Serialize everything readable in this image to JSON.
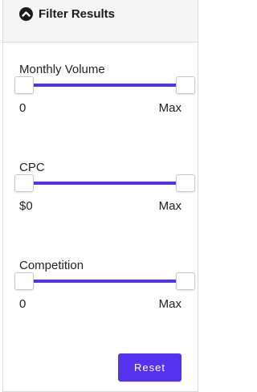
{
  "header": {
    "title": "Filter Results",
    "collapse_icon": "chevron-up-circle-icon"
  },
  "colors": {
    "accent": "#5533ee"
  },
  "filters": [
    {
      "label": "Monthly Volume",
      "min_label": "0",
      "max_label": "Max",
      "range": [
        0,
        1
      ]
    },
    {
      "label": "CPC",
      "min_label": "$0",
      "max_label": "Max",
      "range": [
        0,
        1
      ]
    },
    {
      "label": "Competition",
      "min_label": "0",
      "max_label": "Max",
      "range": [
        0,
        1
      ]
    }
  ],
  "actions": {
    "reset_label": "Reset"
  }
}
